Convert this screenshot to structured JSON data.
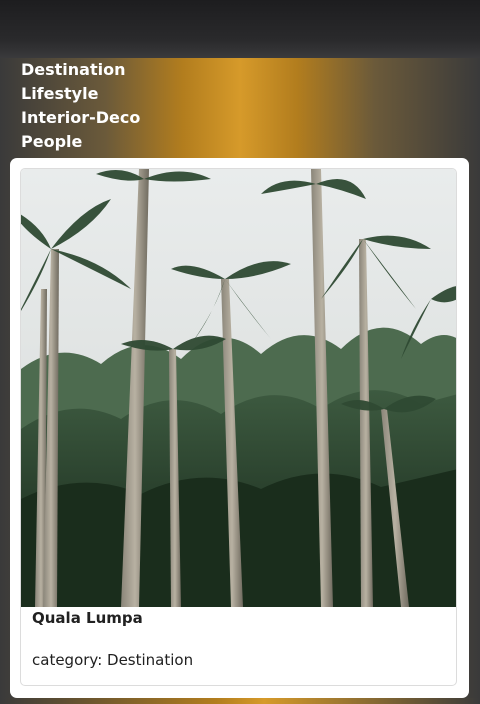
{
  "nav": {
    "items": [
      {
        "label": "Destination"
      },
      {
        "label": "Lifestyle"
      },
      {
        "label": "Interior-Deco"
      },
      {
        "label": "People"
      }
    ]
  },
  "card": {
    "title": "Quala Lumpa",
    "category": "category: Destination",
    "image_subject": "palm-trees-photo"
  },
  "colors": {
    "accent_gold": "#d69a2a",
    "topbar": "#2a2a2c",
    "text": "#212121"
  }
}
